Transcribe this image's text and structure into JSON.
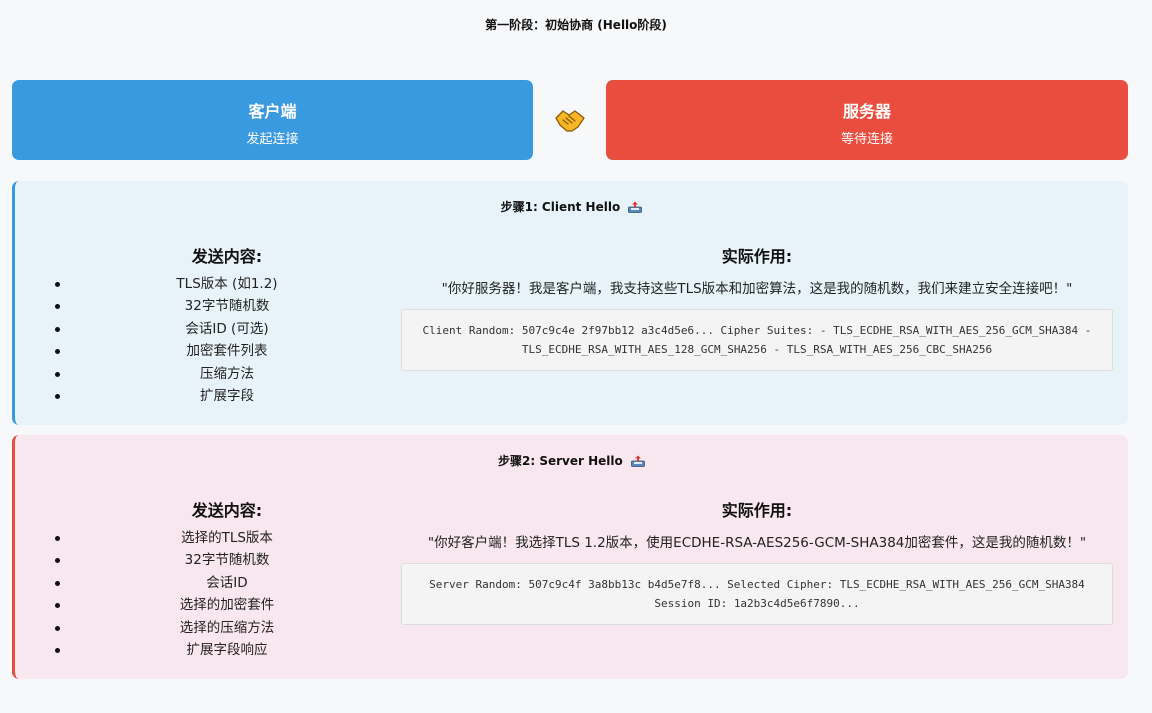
{
  "page": {
    "title": "第一阶段：初始协商 (Hello阶段)"
  },
  "client": {
    "name": "客户端",
    "sub": "发起连接"
  },
  "server": {
    "name": "服务器",
    "sub": "等待连接"
  },
  "steps": [
    {
      "title": "步骤1: Client Hello",
      "left_heading": "发送内容:",
      "items": [
        "TLS版本 (如1.2)",
        "32字节随机数",
        "会话ID (可选)",
        "加密套件列表",
        "压缩方法",
        "扩展字段"
      ],
      "right_heading": "实际作用:",
      "quote": "\"你好服务器！我是客户端，我支持这些TLS版本和加密算法，这是我的随机数，我们来建立安全连接吧！\"",
      "code": "Client Random: 507c9c4e 2f97bb12 a3c4d5e6... Cipher Suites: - TLS_ECDHE_RSA_WITH_AES_256_GCM_SHA384 - TLS_ECDHE_RSA_WITH_AES_128_GCM_SHA256 - TLS_RSA_WITH_AES_256_CBC_SHA256"
    },
    {
      "title": "步骤2: Server Hello",
      "left_heading": "发送内容:",
      "items": [
        "选择的TLS版本",
        "32字节随机数",
        "会话ID",
        "选择的加密套件",
        "选择的压缩方法",
        "扩展字段响应"
      ],
      "right_heading": "实际作用:",
      "quote": "\"你好客户端！我选择TLS 1.2版本，使用ECDHE-RSA-AES256-GCM-SHA384加密套件，这是我的随机数！\"",
      "code": "Server Random: 507c9c4f 3a8bb13c b4d5e7f8... Selected Cipher: TLS_ECDHE_RSA_WITH_AES_256_GCM_SHA384 Session ID: 1a2b3c4d5e6f7890..."
    }
  ],
  "icons": {
    "center": "handshake-icon",
    "step": "outbox-tray-icon"
  },
  "colors": {
    "client": "#3a9ae0",
    "server": "#e84d3d",
    "step1_bg": "#e8f3f9",
    "step2_bg": "#f8e7ee"
  }
}
